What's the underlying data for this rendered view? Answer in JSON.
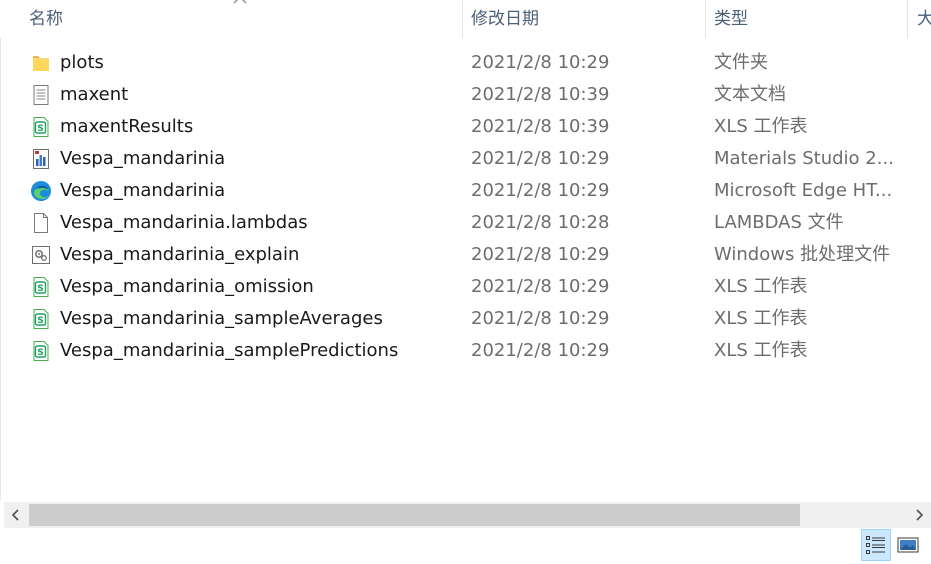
{
  "headers": {
    "name": "名称",
    "date": "修改日期",
    "type": "类型",
    "size": "大"
  },
  "files": [
    {
      "name": "plots",
      "date": "2021/2/8 10:29",
      "type": "文件夹",
      "icon": "folder-icon"
    },
    {
      "name": "maxent",
      "date": "2021/2/8 10:39",
      "type": "文本文档",
      "icon": "text-document-icon"
    },
    {
      "name": "maxentResults",
      "date": "2021/2/8 10:39",
      "type": "XLS 工作表",
      "icon": "spreadsheet-icon"
    },
    {
      "name": "Vespa_mandarinia",
      "date": "2021/2/8 10:29",
      "type": "Materials Studio 2...",
      "icon": "materials-studio-icon"
    },
    {
      "name": "Vespa_mandarinia",
      "date": "2021/2/8 10:29",
      "type": "Microsoft Edge HT...",
      "icon": "edge-icon"
    },
    {
      "name": "Vespa_mandarinia.lambdas",
      "date": "2021/2/8 10:28",
      "type": "LAMBDAS 文件",
      "icon": "blank-file-icon"
    },
    {
      "name": "Vespa_mandarinia_explain",
      "date": "2021/2/8 10:29",
      "type": "Windows 批处理文件",
      "icon": "batch-file-icon"
    },
    {
      "name": "Vespa_mandarinia_omission",
      "date": "2021/2/8 10:29",
      "type": "XLS 工作表",
      "icon": "spreadsheet-icon"
    },
    {
      "name": "Vespa_mandarinia_sampleAverages",
      "date": "2021/2/8 10:29",
      "type": "XLS 工作表",
      "icon": "spreadsheet-icon"
    },
    {
      "name": "Vespa_mandarinia_samplePredictions",
      "date": "2021/2/8 10:29",
      "type": "XLS 工作表",
      "icon": "spreadsheet-icon"
    }
  ],
  "scrollbar": {
    "left_arrow": "‹",
    "right_arrow": "›"
  },
  "colors": {
    "header_text": "#4c607a",
    "secondary_text": "#6d6d6d",
    "folder_yellow": "#f8d775",
    "spreadsheet_green": "#21a366",
    "selected_view_bg": "#cce8ff"
  }
}
